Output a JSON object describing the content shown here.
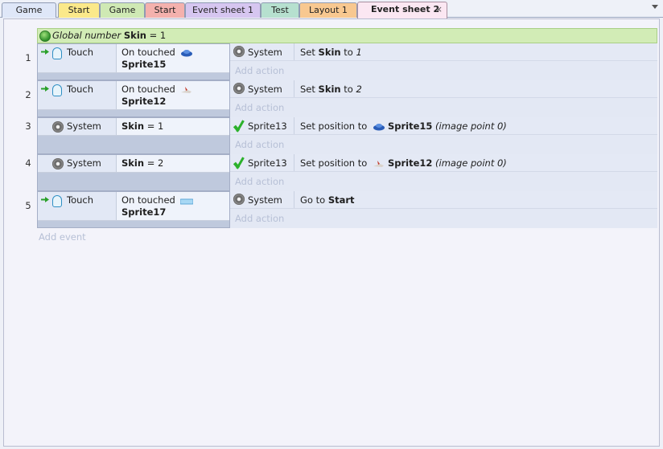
{
  "tabs": [
    {
      "label": "Game",
      "color": "#dfe7f8"
    },
    {
      "label": "Start",
      "color": "#fbe98a"
    },
    {
      "label": "Game",
      "color": "#cfe9b4"
    },
    {
      "label": "Start",
      "color": "#f4b1ad"
    },
    {
      "label": "Event sheet 1",
      "color": "#d6c6f0"
    },
    {
      "label": "Test",
      "color": "#b6e0cf"
    },
    {
      "label": "Layout 1",
      "color": "#f8c890"
    },
    {
      "label": "Event sheet 2",
      "color": "#fbe7f2",
      "active": true,
      "close": "×"
    }
  ],
  "global_var": {
    "prefix": "Global number",
    "name": "Skin",
    "value": "= 1"
  },
  "events": [
    {
      "num": "1",
      "cond": {
        "object": "Touch",
        "text": "On touched",
        "target": "Sprite15",
        "icon": "touch-icon",
        "trigger": true
      },
      "action": {
        "object": "System",
        "text": "Set",
        "var": "Skin",
        "mid": "to",
        "value": "1"
      },
      "add_action": "Add action"
    },
    {
      "num": "2",
      "cond": {
        "object": "Touch",
        "text": "On touched",
        "target": "Sprite12",
        "icon": "touch-icon",
        "trigger": true
      },
      "action": {
        "object": "System",
        "text": "Set",
        "var": "Skin",
        "mid": "to",
        "value": "2"
      },
      "add_action": "Add action"
    },
    {
      "num": "3",
      "cond": {
        "object": "System",
        "var": "Skin",
        "cmp": "= 1",
        "icon": "gear-icon"
      },
      "action": {
        "object": "Sprite13",
        "text": "Set position to",
        "target": "Sprite15",
        "extra": "(image point 0)"
      },
      "add_action": "Add action"
    },
    {
      "num": "4",
      "cond": {
        "object": "System",
        "var": "Skin",
        "cmp": "= 2",
        "icon": "gear-icon"
      },
      "action": {
        "object": "Sprite13",
        "text": "Set position to",
        "target": "Sprite12",
        "extra": "(image point 0)"
      },
      "add_action": "Add action"
    },
    {
      "num": "5",
      "cond": {
        "object": "Touch",
        "text": "On touched",
        "target": "Sprite17",
        "icon": "touch-icon",
        "trigger": true
      },
      "action": {
        "object": "System",
        "text": "Go to",
        "target": "Start"
      },
      "add_action": "Add action"
    }
  ],
  "add_event": "Add event"
}
